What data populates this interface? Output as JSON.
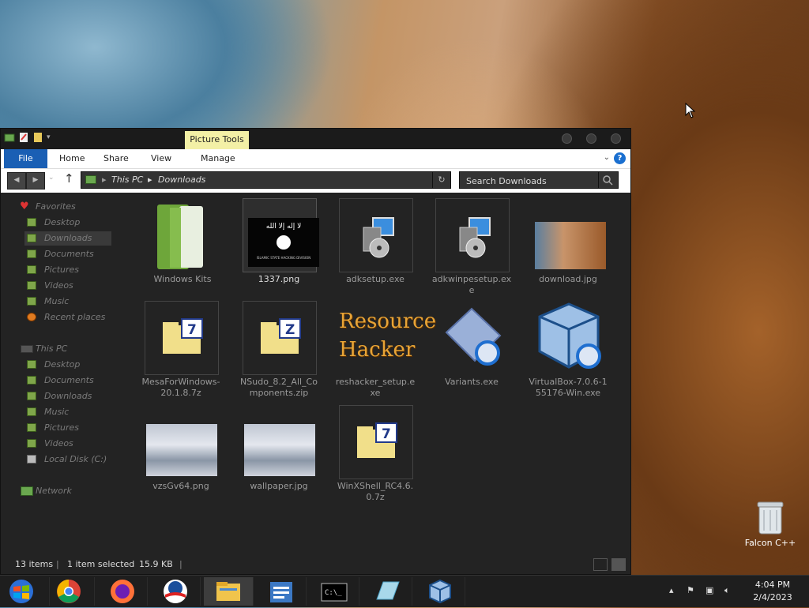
{
  "window": {
    "contextual_tab": "Picture Tools",
    "ribbon_tabs": {
      "file": "File",
      "home": "Home",
      "share": "Share",
      "view": "View",
      "manage": "Manage"
    },
    "breadcrumb": {
      "root": "This PC",
      "folder": "Downloads"
    },
    "search": {
      "placeholder": "Search Downloads"
    }
  },
  "sidebar": {
    "favorites": {
      "header": "Favorites",
      "items": [
        "Desktop",
        "Downloads",
        "Documents",
        "Pictures",
        "Videos",
        "Music",
        "Recent places"
      ],
      "selected": "Downloads"
    },
    "this_pc": {
      "header": "This PC",
      "items": [
        "Desktop",
        "Documents",
        "Downloads",
        "Music",
        "Pictures",
        "Videos",
        "Local Disk (C:)"
      ]
    },
    "network": "Network"
  },
  "files": [
    {
      "name": "Windows Kits",
      "type": "folder"
    },
    {
      "name": "1337.png",
      "type": "image",
      "selected": true
    },
    {
      "name": "adksetup.exe",
      "type": "installer"
    },
    {
      "name": "adkwinpesetup.exe",
      "type": "installer"
    },
    {
      "name": "download.jpg",
      "type": "image"
    },
    {
      "name": "MesaForWindows-20.1.8.7z",
      "type": "archive-7z"
    },
    {
      "name": "NSudo_8.2_All_Components.zip",
      "type": "archive-zip"
    },
    {
      "name": "reshacker_setup.exe",
      "type": "installer"
    },
    {
      "name": "Variants.exe",
      "type": "installer"
    },
    {
      "name": "VirtualBox-7.0.6-155176-Win.exe",
      "type": "installer"
    },
    {
      "name": "vzsGv64.png",
      "type": "image"
    },
    {
      "name": "wallpaper.jpg",
      "type": "image"
    },
    {
      "name": "WinXShell_RC4.6.0.7z",
      "type": "archive-7z"
    }
  ],
  "thumb_text": {
    "flag_text": "لا إله إلا الله",
    "flag_caption": "ISLAMIC STATE HACKING DIVISION",
    "reshacker_line1": "Resource",
    "reshacker_line2": "Hacker"
  },
  "status": {
    "count": "13 items",
    "selection": "1 item selected",
    "size": "15.9 KB"
  },
  "desktop": {
    "recycle_bin_label": "Falcon C++"
  },
  "taskbar": {
    "apps": [
      "start-orb",
      "chrome",
      "firefox",
      "obama-logo",
      "file-explorer",
      "control-panel",
      "command-prompt",
      "notepad",
      "virtualbox"
    ],
    "active": "file-explorer",
    "clock_time": "4:04 PM",
    "clock_date": "2/4/2023"
  },
  "colors": {
    "accent": "#1a5fb4",
    "context_tab": "#f3f0a6",
    "window_bg": "#232323"
  }
}
